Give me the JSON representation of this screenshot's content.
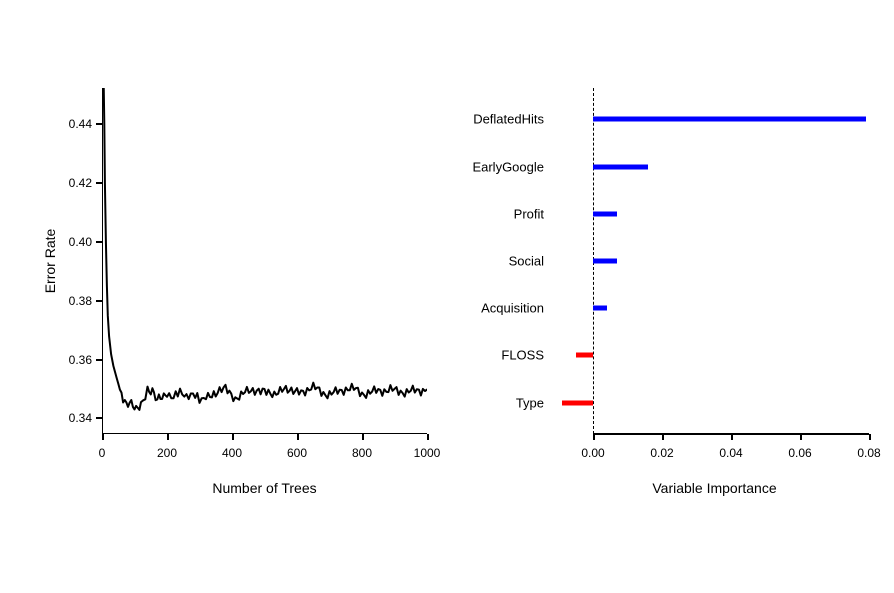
{
  "chart_data": [
    {
      "type": "line",
      "title": "",
      "xlabel": "Number of Trees",
      "ylabel": "Error Rate",
      "xlim": [
        0,
        1000
      ],
      "ylim": [
        0.335,
        0.452
      ],
      "x_ticks": [
        0,
        200,
        400,
        600,
        800,
        1000
      ],
      "y_ticks": [
        0.34,
        0.36,
        0.38,
        0.4,
        0.42,
        0.44
      ],
      "series": [
        {
          "name": "error",
          "color": "#000000",
          "approx_points": [
            [
              1,
              0.5
            ],
            [
              2,
              0.48
            ],
            [
              3,
              0.47
            ],
            [
              4,
              0.46
            ],
            [
              5,
              0.455
            ],
            [
              7,
              0.44
            ],
            [
              9,
              0.42
            ],
            [
              12,
              0.4
            ],
            [
              15,
              0.385
            ],
            [
              18,
              0.375
            ],
            [
              22,
              0.368
            ],
            [
              28,
              0.362
            ],
            [
              35,
              0.358
            ],
            [
              45,
              0.354
            ],
            [
              55,
              0.35
            ],
            [
              65,
              0.348
            ],
            [
              75,
              0.346
            ],
            [
              90,
              0.345
            ],
            [
              105,
              0.344
            ],
            [
              120,
              0.345
            ],
            [
              140,
              0.349
            ],
            [
              155,
              0.35
            ],
            [
              170,
              0.346
            ],
            [
              185,
              0.348
            ],
            [
              200,
              0.35
            ],
            [
              220,
              0.347
            ],
            [
              240,
              0.35
            ],
            [
              260,
              0.346
            ],
            [
              280,
              0.349
            ],
            [
              300,
              0.346
            ],
            [
              320,
              0.349
            ],
            [
              350,
              0.348
            ],
            [
              380,
              0.35
            ],
            [
              410,
              0.347
            ],
            [
              440,
              0.35
            ],
            [
              470,
              0.349
            ],
            [
              500,
              0.35
            ],
            [
              530,
              0.348
            ],
            [
              560,
              0.35
            ],
            [
              600,
              0.349
            ],
            [
              650,
              0.35
            ],
            [
              700,
              0.349
            ],
            [
              750,
              0.35
            ],
            [
              800,
              0.349
            ],
            [
              850,
              0.35
            ],
            [
              900,
              0.349
            ],
            [
              950,
              0.35
            ],
            [
              1000,
              0.35
            ]
          ]
        }
      ]
    },
    {
      "type": "bar_horizontal",
      "title": "",
      "xlabel": "Variable Importance",
      "ylabel": "",
      "xlim": [
        -0.012,
        0.082
      ],
      "x_ticks": [
        0.0,
        0.02,
        0.04,
        0.06,
        0.08
      ],
      "categories": [
        "DeflatedHits",
        "EarlyGoogle",
        "Profit",
        "Social",
        "Acquisition",
        "FLOSS",
        "Type"
      ],
      "values": [
        0.079,
        0.016,
        0.007,
        0.007,
        0.004,
        -0.005,
        -0.009
      ],
      "colors": [
        "#0000FF",
        "#0000FF",
        "#0000FF",
        "#0000FF",
        "#0000FF",
        "#FF0000",
        "#FF0000"
      ],
      "zero_line": 0.0
    }
  ],
  "labels": {
    "x_left": "Number of Trees",
    "y_left": "Error Rate",
    "x_right": "Variable Importance",
    "y_ticks_left": [
      "0.34",
      "0.36",
      "0.38",
      "0.40",
      "0.42",
      "0.44"
    ],
    "x_ticks_left": [
      "0",
      "200",
      "400",
      "600",
      "800",
      "1000"
    ],
    "x_ticks_right": [
      "0.00",
      "0.02",
      "0.04",
      "0.06",
      "0.08"
    ],
    "cats": [
      "DeflatedHits",
      "EarlyGoogle",
      "Profit",
      "Social",
      "Acquisition",
      "FLOSS",
      "Type"
    ]
  }
}
